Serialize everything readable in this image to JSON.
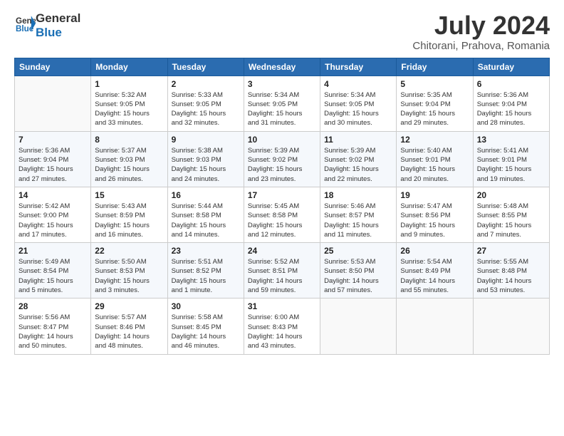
{
  "logo": {
    "line1": "General",
    "line2": "Blue"
  },
  "title": "July 2024",
  "subtitle": "Chitorani, Prahova, Romania",
  "days_of_week": [
    "Sunday",
    "Monday",
    "Tuesday",
    "Wednesday",
    "Thursday",
    "Friday",
    "Saturday"
  ],
  "weeks": [
    [
      {
        "day": "",
        "info": ""
      },
      {
        "day": "1",
        "info": "Sunrise: 5:32 AM\nSunset: 9:05 PM\nDaylight: 15 hours\nand 33 minutes."
      },
      {
        "day": "2",
        "info": "Sunrise: 5:33 AM\nSunset: 9:05 PM\nDaylight: 15 hours\nand 32 minutes."
      },
      {
        "day": "3",
        "info": "Sunrise: 5:34 AM\nSunset: 9:05 PM\nDaylight: 15 hours\nand 31 minutes."
      },
      {
        "day": "4",
        "info": "Sunrise: 5:34 AM\nSunset: 9:05 PM\nDaylight: 15 hours\nand 30 minutes."
      },
      {
        "day": "5",
        "info": "Sunrise: 5:35 AM\nSunset: 9:04 PM\nDaylight: 15 hours\nand 29 minutes."
      },
      {
        "day": "6",
        "info": "Sunrise: 5:36 AM\nSunset: 9:04 PM\nDaylight: 15 hours\nand 28 minutes."
      }
    ],
    [
      {
        "day": "7",
        "info": "Sunrise: 5:36 AM\nSunset: 9:04 PM\nDaylight: 15 hours\nand 27 minutes."
      },
      {
        "day": "8",
        "info": "Sunrise: 5:37 AM\nSunset: 9:03 PM\nDaylight: 15 hours\nand 26 minutes."
      },
      {
        "day": "9",
        "info": "Sunrise: 5:38 AM\nSunset: 9:03 PM\nDaylight: 15 hours\nand 24 minutes."
      },
      {
        "day": "10",
        "info": "Sunrise: 5:39 AM\nSunset: 9:02 PM\nDaylight: 15 hours\nand 23 minutes."
      },
      {
        "day": "11",
        "info": "Sunrise: 5:39 AM\nSunset: 9:02 PM\nDaylight: 15 hours\nand 22 minutes."
      },
      {
        "day": "12",
        "info": "Sunrise: 5:40 AM\nSunset: 9:01 PM\nDaylight: 15 hours\nand 20 minutes."
      },
      {
        "day": "13",
        "info": "Sunrise: 5:41 AM\nSunset: 9:01 PM\nDaylight: 15 hours\nand 19 minutes."
      }
    ],
    [
      {
        "day": "14",
        "info": "Sunrise: 5:42 AM\nSunset: 9:00 PM\nDaylight: 15 hours\nand 17 minutes."
      },
      {
        "day": "15",
        "info": "Sunrise: 5:43 AM\nSunset: 8:59 PM\nDaylight: 15 hours\nand 16 minutes."
      },
      {
        "day": "16",
        "info": "Sunrise: 5:44 AM\nSunset: 8:58 PM\nDaylight: 15 hours\nand 14 minutes."
      },
      {
        "day": "17",
        "info": "Sunrise: 5:45 AM\nSunset: 8:58 PM\nDaylight: 15 hours\nand 12 minutes."
      },
      {
        "day": "18",
        "info": "Sunrise: 5:46 AM\nSunset: 8:57 PM\nDaylight: 15 hours\nand 11 minutes."
      },
      {
        "day": "19",
        "info": "Sunrise: 5:47 AM\nSunset: 8:56 PM\nDaylight: 15 hours\nand 9 minutes."
      },
      {
        "day": "20",
        "info": "Sunrise: 5:48 AM\nSunset: 8:55 PM\nDaylight: 15 hours\nand 7 minutes."
      }
    ],
    [
      {
        "day": "21",
        "info": "Sunrise: 5:49 AM\nSunset: 8:54 PM\nDaylight: 15 hours\nand 5 minutes."
      },
      {
        "day": "22",
        "info": "Sunrise: 5:50 AM\nSunset: 8:53 PM\nDaylight: 15 hours\nand 3 minutes."
      },
      {
        "day": "23",
        "info": "Sunrise: 5:51 AM\nSunset: 8:52 PM\nDaylight: 15 hours\nand 1 minute."
      },
      {
        "day": "24",
        "info": "Sunrise: 5:52 AM\nSunset: 8:51 PM\nDaylight: 14 hours\nand 59 minutes."
      },
      {
        "day": "25",
        "info": "Sunrise: 5:53 AM\nSunset: 8:50 PM\nDaylight: 14 hours\nand 57 minutes."
      },
      {
        "day": "26",
        "info": "Sunrise: 5:54 AM\nSunset: 8:49 PM\nDaylight: 14 hours\nand 55 minutes."
      },
      {
        "day": "27",
        "info": "Sunrise: 5:55 AM\nSunset: 8:48 PM\nDaylight: 14 hours\nand 53 minutes."
      }
    ],
    [
      {
        "day": "28",
        "info": "Sunrise: 5:56 AM\nSunset: 8:47 PM\nDaylight: 14 hours\nand 50 minutes."
      },
      {
        "day": "29",
        "info": "Sunrise: 5:57 AM\nSunset: 8:46 PM\nDaylight: 14 hours\nand 48 minutes."
      },
      {
        "day": "30",
        "info": "Sunrise: 5:58 AM\nSunset: 8:45 PM\nDaylight: 14 hours\nand 46 minutes."
      },
      {
        "day": "31",
        "info": "Sunrise: 6:00 AM\nSunset: 8:43 PM\nDaylight: 14 hours\nand 43 minutes."
      },
      {
        "day": "",
        "info": ""
      },
      {
        "day": "",
        "info": ""
      },
      {
        "day": "",
        "info": ""
      }
    ]
  ]
}
